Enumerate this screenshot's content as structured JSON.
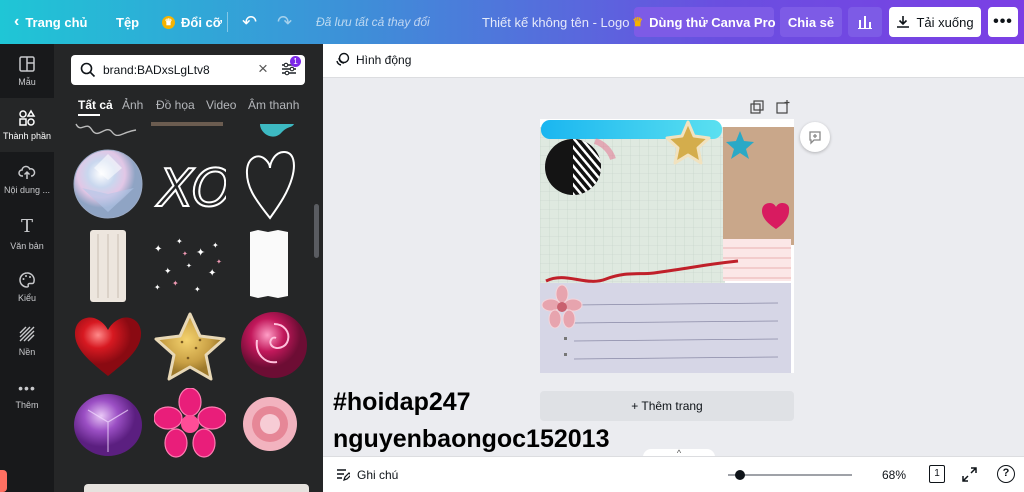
{
  "topbar": {
    "home_label": "Trang chủ",
    "file_label": "Tệp",
    "resize_label": "Đổi cỡ",
    "save_status": "Đã lưu tất cả thay đổi",
    "design_title": "Thiết kế không tên - Logo",
    "try_pro_label": "Dùng thử Canva Pro",
    "share_label": "Chia sẻ",
    "download_label": "Tải xuống"
  },
  "rail": {
    "items": [
      {
        "label": "Mẫu",
        "icon": "template-icon"
      },
      {
        "label": "Thành phần",
        "icon": "elements-icon"
      },
      {
        "label": "Nội dung ...",
        "icon": "upload-icon"
      },
      {
        "label": "Văn bản",
        "icon": "text-icon"
      },
      {
        "label": "Kiểu",
        "icon": "palette-icon"
      },
      {
        "label": "Nền",
        "icon": "background-icon"
      },
      {
        "label": "Thêm",
        "icon": "more-icon"
      }
    ]
  },
  "panel": {
    "search_value": "brand:BADxsLgLtv8",
    "filter_badge": "1",
    "tabs": [
      "Tất cả",
      "Ảnh",
      "Đồ họa",
      "Video",
      "Âm thanh"
    ],
    "xo_text": "XO"
  },
  "editor": {
    "animate_label": "Hình động",
    "add_page_label": "+ Thêm trang",
    "notes_label": "Ghi chú",
    "zoom": "68%",
    "page_count": "1",
    "help": "?"
  },
  "watermark": {
    "line1": "#hoidap247",
    "line2": "nguyenbaongoc152013"
  },
  "colors": {
    "rail_bg": "#18191b",
    "panel_bg": "#252627",
    "pro_button": "#7d5be6",
    "accent_gradient_start": "#1fc6d6",
    "accent_gradient_end": "#7b3fe4"
  }
}
